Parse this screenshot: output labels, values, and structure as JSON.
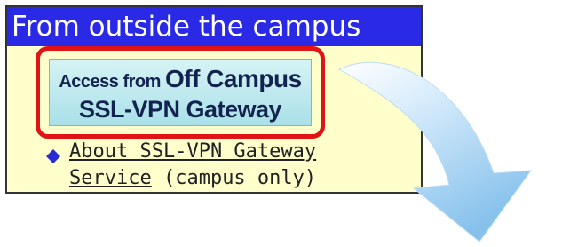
{
  "panel": {
    "title": "From outside the campus",
    "access_button": {
      "line1_small": "Access from ",
      "line1_big": "Off Campus",
      "line2": "SSL-VPN Gateway"
    },
    "link": {
      "line1": "About SSL-VPN Gateway",
      "line2_link": "Service",
      "line2_rest": " (campus only)"
    },
    "bullet_icon": "diamond-icon"
  },
  "arrow_icon": "curved-arrow-icon",
  "colors": {
    "header_bg": "#2a2ae6",
    "panel_bg": "#ffffcc",
    "highlight_border": "#e01414",
    "button_bg": "#a9e0e8",
    "arrow_fill": "#8fc6ee",
    "bullet": "#2b2bd6"
  }
}
